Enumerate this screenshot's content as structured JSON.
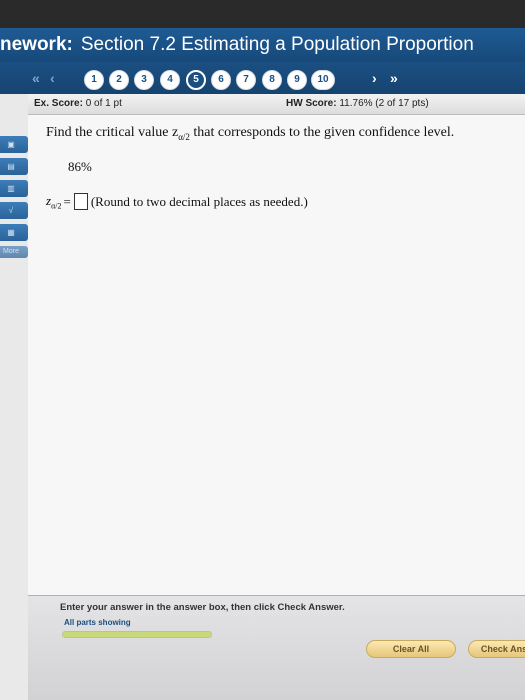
{
  "header": {
    "title_prefix": "nework:",
    "title": "Section 7.2 Estimating a Population Proportion"
  },
  "nav": {
    "first_icon": "«",
    "prev_icon": "‹",
    "next_icon": "›",
    "last_icon": "»",
    "questions": [
      "1",
      "2",
      "3",
      "4",
      "5",
      "6",
      "7",
      "8",
      "9",
      "10"
    ],
    "current_question": "5"
  },
  "scores": {
    "ex_label": "Ex. Score:",
    "ex_value": "0 of 1 pt",
    "hw_label": "HW Score:",
    "hw_value": "11.76% (2 of 17 pts)"
  },
  "sidebar": {
    "more_label": "More"
  },
  "question": {
    "text_before": "Find the critical value z",
    "text_sub": "α/2",
    "text_after": " that corresponds to the given confidence level.",
    "confidence_level": "86%",
    "answer_label_z": "z",
    "answer_label_sub": "α/2",
    "answer_equals": "=",
    "answer_value": "",
    "answer_hint": "(Round to two decimal places as needed.)"
  },
  "footer": {
    "instruction": "Enter your answer in the answer box, then click Check Answer.",
    "parts_label": "All parts showing",
    "progress_fraction": 1.0,
    "clear_all": "Clear All",
    "check_answer": "Check Ans"
  },
  "colors": {
    "header_blue": "#1e5b94",
    "button_gold": "#e6c77a"
  }
}
